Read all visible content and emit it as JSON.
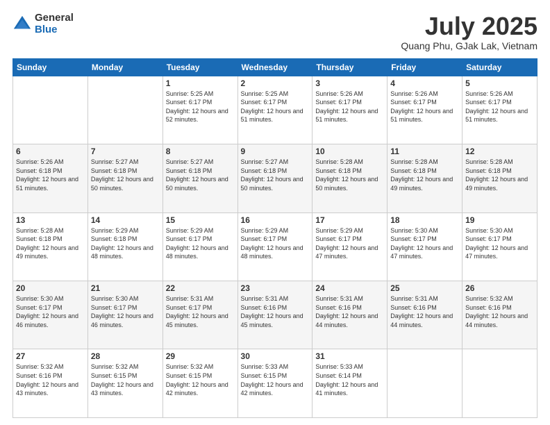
{
  "logo": {
    "general": "General",
    "blue": "Blue"
  },
  "header": {
    "title": "July 2025",
    "subtitle": "Quang Phu, GJak Lak, Vietnam"
  },
  "weekdays": [
    "Sunday",
    "Monday",
    "Tuesday",
    "Wednesday",
    "Thursday",
    "Friday",
    "Saturday"
  ],
  "weeks": [
    [
      {
        "day": "",
        "info": ""
      },
      {
        "day": "",
        "info": ""
      },
      {
        "day": "1",
        "info": "Sunrise: 5:25 AM\nSunset: 6:17 PM\nDaylight: 12 hours and 52 minutes."
      },
      {
        "day": "2",
        "info": "Sunrise: 5:25 AM\nSunset: 6:17 PM\nDaylight: 12 hours and 51 minutes."
      },
      {
        "day": "3",
        "info": "Sunrise: 5:26 AM\nSunset: 6:17 PM\nDaylight: 12 hours and 51 minutes."
      },
      {
        "day": "4",
        "info": "Sunrise: 5:26 AM\nSunset: 6:17 PM\nDaylight: 12 hours and 51 minutes."
      },
      {
        "day": "5",
        "info": "Sunrise: 5:26 AM\nSunset: 6:17 PM\nDaylight: 12 hours and 51 minutes."
      }
    ],
    [
      {
        "day": "6",
        "info": "Sunrise: 5:26 AM\nSunset: 6:18 PM\nDaylight: 12 hours and 51 minutes."
      },
      {
        "day": "7",
        "info": "Sunrise: 5:27 AM\nSunset: 6:18 PM\nDaylight: 12 hours and 50 minutes."
      },
      {
        "day": "8",
        "info": "Sunrise: 5:27 AM\nSunset: 6:18 PM\nDaylight: 12 hours and 50 minutes."
      },
      {
        "day": "9",
        "info": "Sunrise: 5:27 AM\nSunset: 6:18 PM\nDaylight: 12 hours and 50 minutes."
      },
      {
        "day": "10",
        "info": "Sunrise: 5:28 AM\nSunset: 6:18 PM\nDaylight: 12 hours and 50 minutes."
      },
      {
        "day": "11",
        "info": "Sunrise: 5:28 AM\nSunset: 6:18 PM\nDaylight: 12 hours and 49 minutes."
      },
      {
        "day": "12",
        "info": "Sunrise: 5:28 AM\nSunset: 6:18 PM\nDaylight: 12 hours and 49 minutes."
      }
    ],
    [
      {
        "day": "13",
        "info": "Sunrise: 5:28 AM\nSunset: 6:18 PM\nDaylight: 12 hours and 49 minutes."
      },
      {
        "day": "14",
        "info": "Sunrise: 5:29 AM\nSunset: 6:18 PM\nDaylight: 12 hours and 48 minutes."
      },
      {
        "day": "15",
        "info": "Sunrise: 5:29 AM\nSunset: 6:17 PM\nDaylight: 12 hours and 48 minutes."
      },
      {
        "day": "16",
        "info": "Sunrise: 5:29 AM\nSunset: 6:17 PM\nDaylight: 12 hours and 48 minutes."
      },
      {
        "day": "17",
        "info": "Sunrise: 5:29 AM\nSunset: 6:17 PM\nDaylight: 12 hours and 47 minutes."
      },
      {
        "day": "18",
        "info": "Sunrise: 5:30 AM\nSunset: 6:17 PM\nDaylight: 12 hours and 47 minutes."
      },
      {
        "day": "19",
        "info": "Sunrise: 5:30 AM\nSunset: 6:17 PM\nDaylight: 12 hours and 47 minutes."
      }
    ],
    [
      {
        "day": "20",
        "info": "Sunrise: 5:30 AM\nSunset: 6:17 PM\nDaylight: 12 hours and 46 minutes."
      },
      {
        "day": "21",
        "info": "Sunrise: 5:30 AM\nSunset: 6:17 PM\nDaylight: 12 hours and 46 minutes."
      },
      {
        "day": "22",
        "info": "Sunrise: 5:31 AM\nSunset: 6:17 PM\nDaylight: 12 hours and 45 minutes."
      },
      {
        "day": "23",
        "info": "Sunrise: 5:31 AM\nSunset: 6:16 PM\nDaylight: 12 hours and 45 minutes."
      },
      {
        "day": "24",
        "info": "Sunrise: 5:31 AM\nSunset: 6:16 PM\nDaylight: 12 hours and 44 minutes."
      },
      {
        "day": "25",
        "info": "Sunrise: 5:31 AM\nSunset: 6:16 PM\nDaylight: 12 hours and 44 minutes."
      },
      {
        "day": "26",
        "info": "Sunrise: 5:32 AM\nSunset: 6:16 PM\nDaylight: 12 hours and 44 minutes."
      }
    ],
    [
      {
        "day": "27",
        "info": "Sunrise: 5:32 AM\nSunset: 6:16 PM\nDaylight: 12 hours and 43 minutes."
      },
      {
        "day": "28",
        "info": "Sunrise: 5:32 AM\nSunset: 6:15 PM\nDaylight: 12 hours and 43 minutes."
      },
      {
        "day": "29",
        "info": "Sunrise: 5:32 AM\nSunset: 6:15 PM\nDaylight: 12 hours and 42 minutes."
      },
      {
        "day": "30",
        "info": "Sunrise: 5:33 AM\nSunset: 6:15 PM\nDaylight: 12 hours and 42 minutes."
      },
      {
        "day": "31",
        "info": "Sunrise: 5:33 AM\nSunset: 6:14 PM\nDaylight: 12 hours and 41 minutes."
      },
      {
        "day": "",
        "info": ""
      },
      {
        "day": "",
        "info": ""
      }
    ]
  ]
}
